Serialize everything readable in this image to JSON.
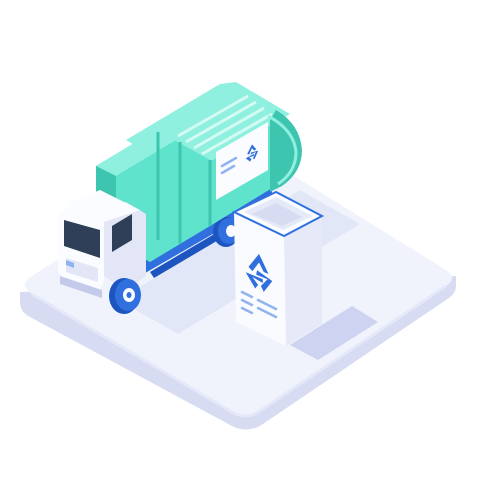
{
  "scene": {
    "subject": "recycling-garbage-truck-with-bin",
    "icons": [
      "recycle-icon"
    ]
  },
  "colors": {
    "background": "#ffffff",
    "platform_top": "#f1f3fc",
    "platform_side": "#d7dcf3",
    "platform_shadow": "#c4cbea",
    "body_teal": "#5fe3cd",
    "body_teal_dark": "#3ec5b0",
    "body_teal_light": "#8ff0df",
    "cab_white": "#fbfcff",
    "cab_shade": "#e2e6f6",
    "window_dark": "#2e3f57",
    "accent_blue": "#2f6fde",
    "accent_blue_dark": "#1d55c0",
    "bin_white": "#f9fbff",
    "bin_shade": "#e5e9f8",
    "label_blue": "#8fb3ef"
  }
}
